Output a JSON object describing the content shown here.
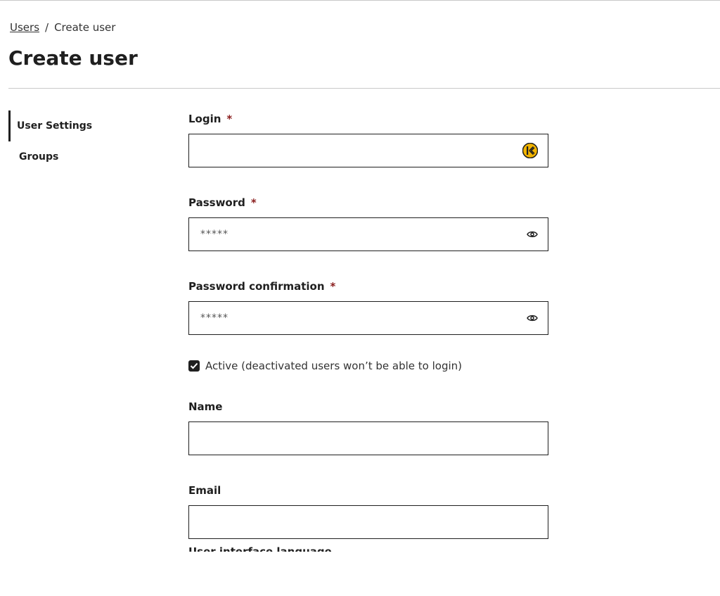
{
  "breadcrumb": {
    "parent": "Users",
    "separator": "/",
    "current": "Create user"
  },
  "page": {
    "title": "Create user"
  },
  "sidebar": {
    "items": [
      {
        "label": "User Settings",
        "active": true
      },
      {
        "label": "Groups",
        "active": false
      }
    ]
  },
  "form": {
    "login": {
      "label": "Login",
      "required_mark": "*",
      "value": "",
      "placeholder": "",
      "icon": "keeper-icon"
    },
    "password": {
      "label": "Password",
      "required_mark": "*",
      "value": "",
      "placeholder": "*****",
      "icon": "eye-icon"
    },
    "password_confirmation": {
      "label": "Password confirmation",
      "required_mark": "*",
      "value": "",
      "placeholder": "*****",
      "icon": "eye-icon"
    },
    "active": {
      "label": "Active (deactivated users won’t be able to login)",
      "checked": true
    },
    "name": {
      "label": "Name",
      "value": "",
      "placeholder": ""
    },
    "email": {
      "label": "Email",
      "value": "",
      "placeholder": ""
    },
    "next_field": {
      "label": "User interface language"
    }
  },
  "colors": {
    "text": "#1f1f1f",
    "required": "#8a1c1c",
    "divider": "#c9c9c9",
    "keeper_icon": "#f2b400"
  }
}
